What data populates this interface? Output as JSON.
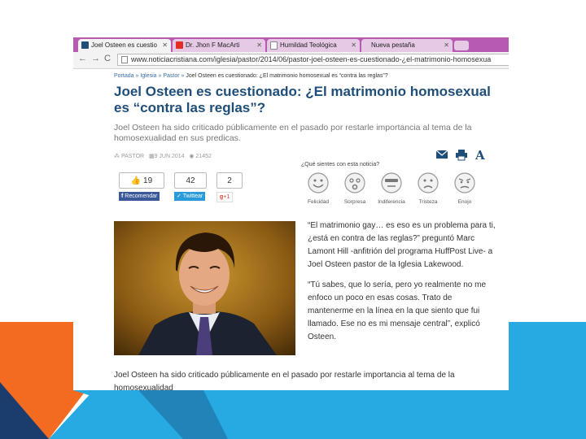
{
  "browser": {
    "tabs": [
      {
        "label": "Joel Osteen es cuestio",
        "active": true
      },
      {
        "label": "Dr. Jhon F MacArti",
        "active": false
      },
      {
        "label": "Humildad Teológica",
        "active": false
      },
      {
        "label": "Nueva pestaña",
        "active": false
      }
    ],
    "url": "www.noticiacristiana.com/iglesia/pastor/2014/06/pastor-joel-osteen-es-cuestionado-¿el-matrimonio-homosexua"
  },
  "article": {
    "breadcrumb": {
      "home": "Portada",
      "section": "Iglesia",
      "subsection": "Pastor",
      "current": "Joel Osteen es cuestionado: ¿El matrimonio homosexual es “contra las reglas”?"
    },
    "title": "Joel Osteen es cuestionado: ¿El matrimonio homosexual es “contra las reglas”?",
    "summary": "Joel Osteen ha sido criticado públicamente en el pasado por restarle importancia al tema de la homosexualidad en sus predicas.",
    "meta": {
      "category": "PASTOR",
      "date": "9 JUN 2014",
      "views": "21452"
    },
    "social": {
      "fb_count": "19",
      "fb_label": "Recomendar",
      "tw_count": "42",
      "tw_label": "Twittear",
      "gplus_count": "2",
      "gplus_label": "+1"
    },
    "feelings": {
      "question": "¿Qué sientes con esta noticia?",
      "options": [
        "Felicidad",
        "Sorpresa",
        "Indiferencia",
        "Tristeza",
        "Enojo"
      ]
    },
    "quote1": "“El matrimonio gay… es eso es un problema para ti, ¿está en contra de las reglas?” preguntó Marc Lamont Hill -anfitrión del programa HuffPost Live- a Joel Osteen pastor de la Iglesia Lakewood.",
    "quote2": "“Tú sabes, que lo sería, pero yo realmente no me enfoco un poco en esas cosas. Trato de mantenerme en la línea en la que siento que fui llamado. Ese no es mi mensaje central”, explicó Osteen.",
    "body": "Joel Osteen ha sido criticado públicamente en el pasado por restarle importancia al tema de la homosexualidad"
  },
  "colors": {
    "tabbar": "#b65ab3",
    "title": "#1f4e79",
    "link": "#3a6ea5",
    "deco_orange": "#f26b21",
    "deco_blue": "#27a9e1",
    "deco_navy": "#1b3d6d"
  }
}
